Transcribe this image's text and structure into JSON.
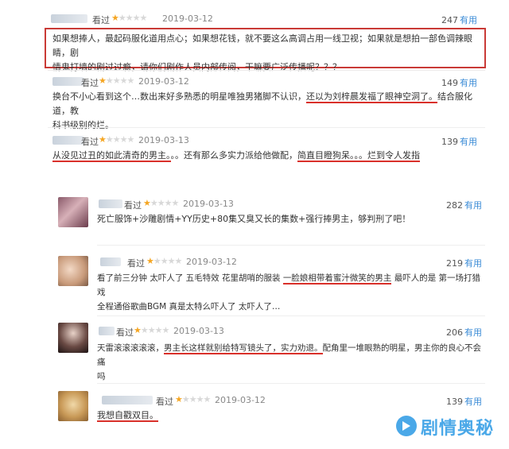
{
  "reviews": [
    {
      "label": "看过",
      "date": "2019-03-12",
      "rating": 1,
      "useful_count": "247",
      "useful_label": "有用",
      "line1": "如果想捧人，最起码服化道用点心；如果想花钱，就不要这么高调占用一线卫视；如果就是想拍一部色调辣眼睛，剧",
      "line2": "情鬼打墙的剧过过瘾，请你们剧作人员内部传阅，干嘛要广泛传播呢？？？"
    },
    {
      "label": "看过",
      "date": "2019-03-12",
      "rating": 1,
      "useful_count": "149",
      "useful_label": "有用",
      "line1_a": "换台不小心看到这个…数出来好多熟悉的明星唯独男猪脚不认识，",
      "line1_b": "还以为刘梓晨发福了眼神空洞了。",
      "line1_c": "结合服化道，教",
      "line2": "科书级别的烂。"
    },
    {
      "label": "看过",
      "date": "2019-03-13",
      "rating": 1,
      "useful_count": "139",
      "useful_label": "有用",
      "line1_a": "从没见过丑的如此清奇的男主。",
      "line1_b": "。。还有那么多实力派给他做配，",
      "line1_c": "简直目瞪狗呆。。。烂到令人发指"
    },
    {
      "label": "看过",
      "date": "2019-03-13",
      "rating": 1,
      "useful_count": "282",
      "useful_label": "有用",
      "line1": "死亡服饰+沙雕剧情+YY历史+80集又臭又长的集数+强行捧男主，够判刑了吧！"
    },
    {
      "label": "看过",
      "date": "2019-03-12",
      "rating": 1,
      "useful_count": "219",
      "useful_label": "有用",
      "line1_a": "看了前三分钟 太吓人了 五毛特效 花里胡哨的服装 ",
      "line1_b": "一脸娘相带着蜜汁微笑的男主",
      "line1_c": " 最吓人的是 第一场打猎戏",
      "line2": "全程通俗歌曲BGM 真是太特么吓人了 太吓人了…"
    },
    {
      "label": "看过",
      "date": "2019-03-13",
      "rating": 1,
      "useful_count": "206",
      "useful_label": "有用",
      "line1_a": "天雷滚滚滚滚滚，",
      "line1_b": "男主长这样就别给特写镜头了，实力劝退。",
      "line1_c": "配角里一堆眼熟的明星，男主你的良心不会痛",
      "line2": "吗"
    },
    {
      "label": "看过",
      "date": "2019-03-12",
      "rating": 1,
      "useful_count": "139",
      "useful_label": "有用",
      "line1": "我想自戳双目。"
    }
  ],
  "watermark": {
    "text": "剧情奥秘"
  },
  "colors": {
    "star": "#f5a623",
    "underline": "#d9302a",
    "box": "#c93a36",
    "useful": "#3a8bd6",
    "watermark": "#4aa8e8"
  }
}
